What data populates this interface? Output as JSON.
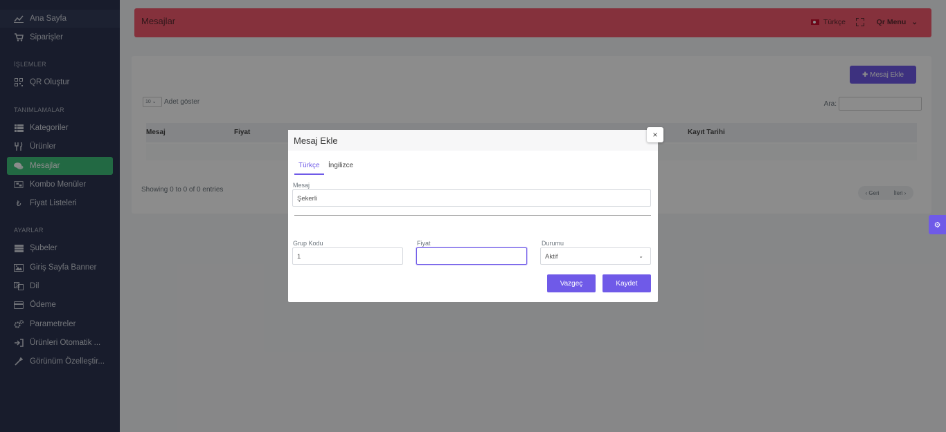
{
  "sidebar": {
    "items": [
      {
        "label": "Ana Sayfa",
        "icon": "chart-line-icon"
      },
      {
        "label": "Siparişler",
        "icon": "cart-icon"
      },
      {
        "label": "QR Oluştur",
        "icon": "qrcode-icon"
      },
      {
        "label": "Kategoriler",
        "icon": "list-icon"
      },
      {
        "label": "Ürünler",
        "icon": "utensils-icon"
      },
      {
        "label": "Mesajlar",
        "icon": "comments-icon"
      },
      {
        "label": "Kombo Menüler",
        "icon": "combo-icon"
      },
      {
        "label": "Fiyat Listeleri",
        "icon": "lira-icon"
      },
      {
        "label": "Şubeler",
        "icon": "branches-icon"
      },
      {
        "label": "Giriş Sayfa Banner",
        "icon": "image-icon"
      },
      {
        "label": "Dil",
        "icon": "language-icon"
      },
      {
        "label": "Ödeme",
        "icon": "credit-card-icon"
      },
      {
        "label": "Parametreler",
        "icon": "cogs-icon"
      },
      {
        "label": "Ürünleri Otomatik ...",
        "icon": "sign-in-icon"
      },
      {
        "label": "Görünüm Özelleştir...",
        "icon": "eyedropper-icon"
      }
    ],
    "sections": {
      "islemler": "İŞLEMLER",
      "tanimlamalar": "TANIMLAMALAR",
      "ayarlar": "AYARLAR"
    }
  },
  "header": {
    "title": "Mesajlar",
    "language": "Türkçe",
    "menu": "Qr Menu"
  },
  "card": {
    "add_button": "✚ Mesaj Ekle",
    "length_value": "10",
    "length_label": "Adet göster",
    "search_label": "Ara:",
    "columns": [
      "Mesaj",
      "Fiyat",
      "Kayıt Tarihi"
    ],
    "info": "Showing 0 to 0 of 0 entries",
    "prev": "‹ Geri",
    "next": "İleri ›"
  },
  "modal": {
    "title": "Mesaj Ekle",
    "close": "×",
    "tabs": [
      "Türkçe",
      "İngilizce"
    ],
    "mesaj_label": "Mesaj",
    "mesaj_value": "Şekerli",
    "grup_label": "Grup Kodu",
    "grup_value": "1",
    "fiyat_label": "Fiyat",
    "fiyat_value": "",
    "durum_label": "Durumu",
    "durum_value": "Aktif",
    "cancel": "Vazgeç",
    "save": "Kaydet"
  },
  "colors": {
    "accent": "#6f5ae8",
    "active_nav": "#3fbf7a",
    "header": "#f35a6e",
    "sidebar": "#2c3450"
  }
}
